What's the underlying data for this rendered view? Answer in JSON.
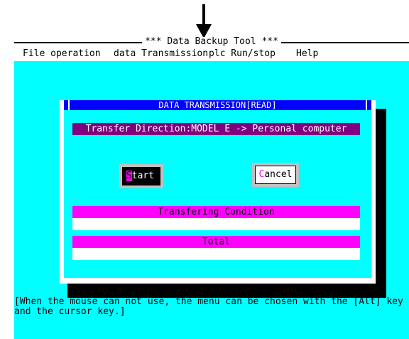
{
  "window": {
    "title": "*** Data Backup Tool ***"
  },
  "menu": {
    "items": [
      {
        "label": "File operation"
      },
      {
        "label": "data Transmission"
      },
      {
        "label": "plc Run/stop"
      },
      {
        "label": "Help"
      }
    ]
  },
  "dialog": {
    "title": "DATA TRANSMISSION[READ]",
    "direction": "Transfer Direction:MODEL E -> Personal computer",
    "start_button": {
      "mnemonic": "S",
      "rest": "tart"
    },
    "cancel_button": {
      "mnemonic": "C",
      "rest": "ancel"
    },
    "transfer_condition_label": "Transfering Condition",
    "total_label": "Total",
    "progress_condition": 0,
    "progress_total": 0
  },
  "status": {
    "help_text": "[When the mouse can not use, the menu can be chosen with the [Alt] key and the cursor key.]"
  },
  "colors": {
    "background": "#00ffff",
    "dialog_title": "#0000ff",
    "direction_bar": "#800080",
    "highlight_bar": "#ff00ff"
  },
  "icons": {
    "pointer": "down-arrow-icon"
  }
}
